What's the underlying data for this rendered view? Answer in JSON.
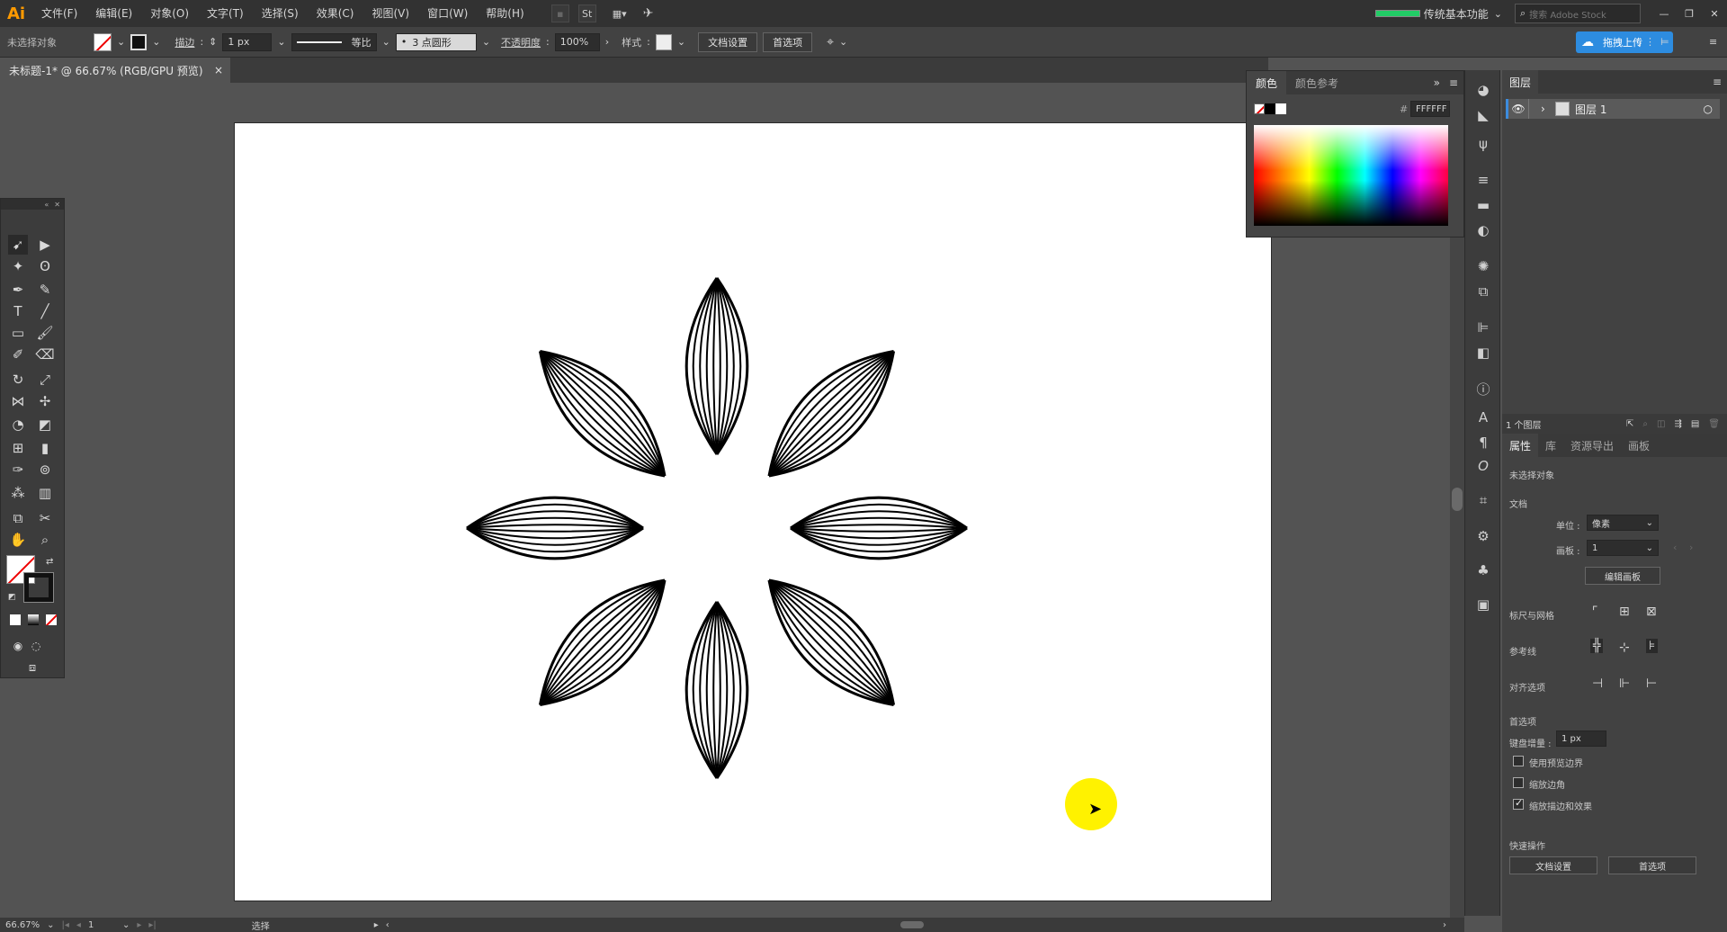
{
  "menubar": {
    "logo": "Ai",
    "items": [
      "文件(F)",
      "编辑(E)",
      "对象(O)",
      "文字(T)",
      "选择(S)",
      "效果(C)",
      "视图(V)",
      "窗口(W)",
      "帮助(H)"
    ],
    "st_label": "St",
    "workspace": "传统基本功能",
    "search_placeholder": "搜索 Adobe Stock"
  },
  "controlbar": {
    "selection": "未选择对象",
    "stroke_label": "描边",
    "stroke_value": "1 px",
    "profile_label": "等比",
    "brush_label": "3 点圆形",
    "opacity_label": "不透明度",
    "opacity_value": "100%",
    "style_label": "样式",
    "doc_setup": "文档设置",
    "preferences": "首选项",
    "upload_btn": "拖拽上传"
  },
  "tab": {
    "title": "未标题-1* @ 66.67% (RGB/GPU 预览)",
    "close": "×"
  },
  "colorpanel": {
    "tabs": [
      "颜色",
      "颜色参考"
    ],
    "hex_prefix": "#",
    "hex_value": "FFFFFF"
  },
  "layers": {
    "tab": "图层",
    "layer_name": "图层 1",
    "count": "1 个图层"
  },
  "properties": {
    "tabs": [
      "属性",
      "库",
      "资源导出",
      "画板"
    ],
    "no_selection": "未选择对象",
    "doc_section": "文档",
    "units_label": "单位 :",
    "units_value": "像素",
    "artboard_label": "画板 :",
    "artboard_value": "1",
    "edit_artboard": "编辑画板",
    "rulers_grid": "标尺与网格",
    "guides": "参考线",
    "align_options": "对齐选项",
    "prefs_section": "首选项",
    "keyboard_inc_label": "键盘增量 :",
    "keyboard_inc_value": "1 px",
    "use_preview_bounds": "使用预览边界",
    "scale_corners": "缩放边角",
    "scale_strokes": "缩放描边和效果",
    "quick_actions": "快速操作",
    "doc_setup": "文档设置",
    "preferences": "首选项"
  },
  "statusbar": {
    "zoom": "66.67%",
    "artboard_nav": "1",
    "tool_name": "选择"
  },
  "artwork": {
    "petal_count": 8,
    "stroke_color": "#000000"
  }
}
